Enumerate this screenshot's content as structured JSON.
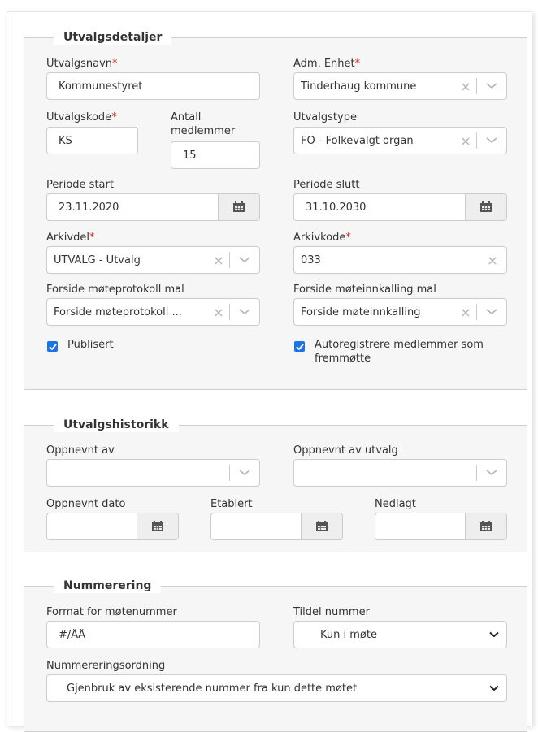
{
  "details": {
    "legend": "Utvalgsdetaljer",
    "utvalgsnavn": {
      "label": "Utvalgsnavn",
      "value": "Kommunestyret"
    },
    "adm_enhet": {
      "label": "Adm. Enhet",
      "value": "Tinderhaug kommune"
    },
    "utvalgskode": {
      "label": "Utvalgskode",
      "value": "KS"
    },
    "antall": {
      "label_line1": "Antall",
      "label_line2": "medlemmer",
      "value": "15"
    },
    "utvalgstype": {
      "label": "Utvalgstype",
      "value": "FO - Folkevalgt organ"
    },
    "periode_start": {
      "label": "Periode start",
      "value": "23.11.2020"
    },
    "periode_slutt": {
      "label": "Periode slutt",
      "value": "31.10.2030"
    },
    "arkivdel": {
      "label": "Arkivdel",
      "value": "UTVALG - Utvalg"
    },
    "arkivkode": {
      "label": "Arkivkode",
      "value": "033"
    },
    "forside_protokoll": {
      "label": "Forside møteprotokoll mal",
      "value": "Forside møteprotokoll ..."
    },
    "forside_innkalling": {
      "label": "Forside møteinnkalling mal",
      "value": "Forside møteinnkalling"
    },
    "publisert": {
      "label": "Publisert",
      "checked": true
    },
    "autoregistrere": {
      "label_line1": "Autoregistrere medlemmer som",
      "label_line2": "fremmøtte",
      "checked": true
    },
    "required_mark": "*"
  },
  "history": {
    "legend": "Utvalgshistorikk",
    "oppnevnt_av": {
      "label": "Oppnevnt av",
      "value": ""
    },
    "oppnevnt_av_utvalg": {
      "label": "Oppnevnt av utvalg",
      "value": ""
    },
    "oppnevnt_dato": {
      "label": "Oppnevnt dato",
      "value": ""
    },
    "etablert": {
      "label": "Etablert",
      "value": ""
    },
    "nedlagt": {
      "label": "Nedlagt",
      "value": ""
    }
  },
  "numbering": {
    "legend": "Nummerering",
    "format": {
      "label": "Format for møtenummer",
      "value": "#/ÅÅ"
    },
    "tildel": {
      "label": "Tildel nummer",
      "value": "Kun i møte"
    },
    "ordning": {
      "label": "Nummereringsordning",
      "value": "Gjenbruk av eksisterende nummer fra kun dette møtet"
    }
  },
  "icons": {
    "clear": "×"
  },
  "colors": {
    "accent": "#1a73e8",
    "required": "#d9241c",
    "section_bg": "#f6f6f6"
  }
}
